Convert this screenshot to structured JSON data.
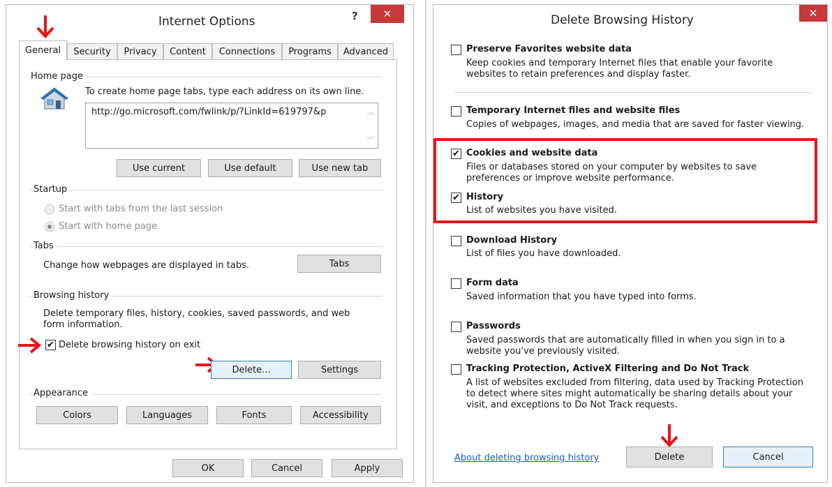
{
  "internet_options": {
    "title": "Internet Options",
    "help_glyph": "?",
    "close_glyph": "✕",
    "tabs": [
      "General",
      "Security",
      "Privacy",
      "Content",
      "Connections",
      "Programs",
      "Advanced"
    ],
    "home_page": {
      "label": "Home page",
      "instruction": "To create home page tabs, type each address on its own line.",
      "url_value": "http://go.microsoft.com/fwlink/p/?LinkId=619797&p",
      "buttons": [
        "Use current",
        "Use default",
        "Use new tab"
      ]
    },
    "startup": {
      "label": "Startup",
      "options": [
        "Start with tabs from the last session",
        "Start with home page"
      ],
      "selected_index": 1
    },
    "tabs_group": {
      "label": "Tabs",
      "text": "Change how webpages are displayed in tabs.",
      "button": "Tabs"
    },
    "browsing_history": {
      "label": "Browsing history",
      "description_line1": "Delete temporary files, history, cookies, saved passwords, and web",
      "description_line2": "form information.",
      "delete_on_exit_label": "Delete browsing history on exit",
      "delete_on_exit_checked": true,
      "delete_button": "Delete...",
      "settings_button": "Settings"
    },
    "appearance": {
      "label": "Appearance",
      "buttons": [
        "Colors",
        "Languages",
        "Fonts",
        "Accessibility"
      ]
    },
    "footer_buttons": [
      "OK",
      "Cancel",
      "Apply"
    ]
  },
  "delete_history": {
    "title": "Delete Browsing History",
    "close_glyph": "✕",
    "options": [
      {
        "title": "Preserve Favorites website data",
        "desc": "Keep cookies and temporary Internet files that enable your favorite websites to retain preferences and display faster.",
        "checked": false
      },
      {
        "title": "Temporary Internet files and website files",
        "desc": "Copies of webpages, images, and media that are saved for faster viewing.",
        "checked": false
      },
      {
        "title": "Cookies and website data",
        "desc": "Files or databases stored on your computer by websites to save preferences or improve website performance.",
        "checked": true
      },
      {
        "title": "History",
        "desc": "List of websites you have visited.",
        "checked": true
      },
      {
        "title": "Download History",
        "desc": "List of files you have downloaded.",
        "checked": false
      },
      {
        "title": "Form data",
        "desc": "Saved information that you have typed into forms.",
        "checked": false
      },
      {
        "title": "Passwords",
        "desc": "Saved passwords that are automatically filled in when you sign in to a website you've previously visited.",
        "checked": false
      },
      {
        "title": "Tracking Protection, ActiveX Filtering and Do Not Track",
        "desc": "A list of websites excluded from filtering, data used by Tracking Protection to detect where sites might automatically be sharing details about your visit, and exceptions to Do Not Track requests.",
        "checked": false
      }
    ],
    "about_link": "About deleting browsing history",
    "delete_button": "Delete",
    "cancel_button": "Cancel"
  },
  "check_glyph": "✔",
  "colors": {
    "annotation_red": "#e8141b",
    "close_red": "#c7383a",
    "link_blue": "#1a56c8",
    "focus_blue": "#3c7fb1"
  }
}
